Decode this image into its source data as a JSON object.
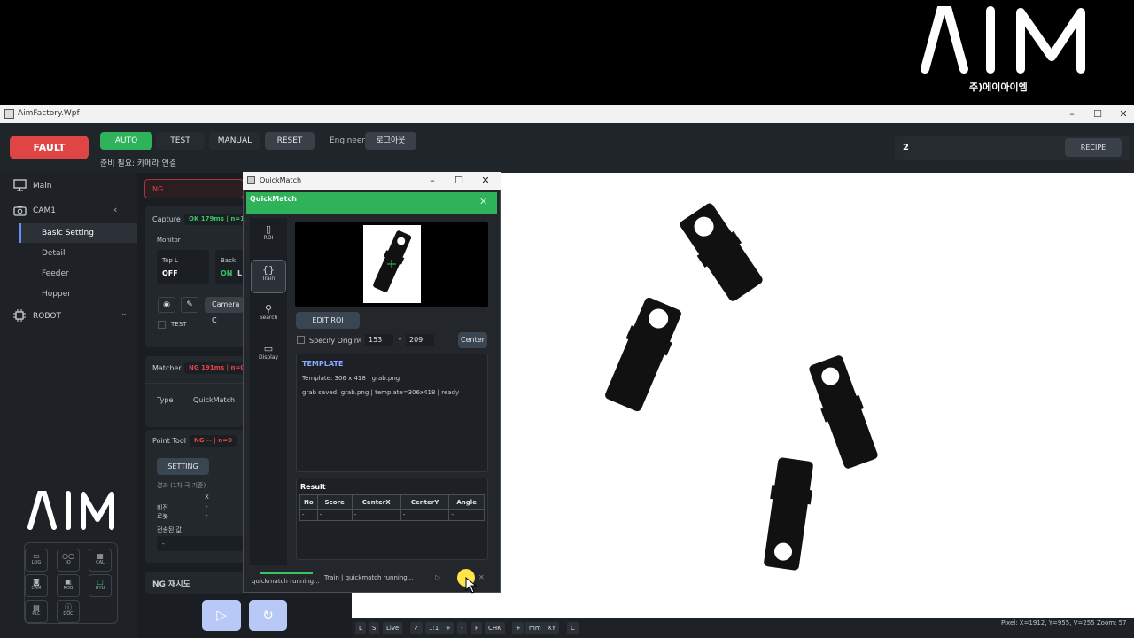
{
  "brand": {
    "logo_text": "AIM",
    "company_korean": "주)에이아이엠"
  },
  "window": {
    "title": "AimFactory.Wpf",
    "controls": [
      "–",
      "☐",
      "✕"
    ]
  },
  "topbar": {
    "fault": "FAULT",
    "modes": [
      "AUTO",
      "TEST",
      "MANUAL"
    ],
    "reset": "RESET",
    "user_role": "Engineer",
    "logout": "로그아웃",
    "status": "준비 필요: 카메라 연결",
    "count": "2",
    "recipe": "RECIPE"
  },
  "sidebar": {
    "main": "Main",
    "cam1": "CAM1",
    "cam1_items": [
      "Basic Setting",
      "Detail",
      "Feeder",
      "Hopper"
    ],
    "robot": "ROBOT",
    "logo": "AIM",
    "quick": [
      {
        "label": "LOG",
        "glyph": "▭"
      },
      {
        "label": "IO",
        "glyph": "○○"
      },
      {
        "label": "CAL",
        "glyph": "▦"
      },
      {
        "label": "CAM",
        "glyph": "◙"
      },
      {
        "label": "ROB",
        "glyph": "▣"
      },
      {
        "label": "HYU",
        "glyph": "□"
      },
      {
        "label": "PLC",
        "glyph": "▤"
      },
      {
        "label": "DOC",
        "glyph": "ⓘ"
      }
    ],
    "quick_hyu_color": "#37c463"
  },
  "middle": {
    "ng_field": "NG",
    "capture": {
      "title": "Capture",
      "status": "OK 179ms | n=1",
      "monitor": "Monitor",
      "top_l": "Top L",
      "top_l_val": "OFF",
      "back": "Back",
      "back_val": "ON",
      "back_extra": "L",
      "camera_btn": "Camera C",
      "test": "TEST"
    },
    "matcher": {
      "title": "Matcher",
      "status": "NG 191ms | n=0",
      "type_label": "Type",
      "type_val": "QuickMatch"
    },
    "point_tool": {
      "title": "Point Tool",
      "status": "NG -- | n=0",
      "setting": "SETTING",
      "result_label": "결과 (1차 국 기준)",
      "x_label": "X",
      "vision": "비전",
      "robot": "로봇",
      "vision_x": "-",
      "robot_x": "-",
      "sent": "전송된 값",
      "sent_val": "-"
    },
    "retry": "NG 재시도"
  },
  "quickmatch": {
    "title": "QuickMatch",
    "header": "QuickMatch",
    "tools": [
      "ROI",
      "Train",
      "Search",
      "Display"
    ],
    "edit_roi": "EDIT ROI",
    "specify_origin": "Specify Origin",
    "x_label": "X",
    "x_val": "153",
    "y_label": "Y",
    "y_val": "209",
    "center": "Center",
    "template_title": "TEMPLATE",
    "template_line1": "Template: 306 x 418 | grab.png",
    "template_line2": "grab saved: grab.png | template=306x418 | ready",
    "result_title": "Result",
    "columns": [
      "No",
      "Score",
      "CenterX",
      "CenterY",
      "Angle"
    ],
    "rows": [
      [
        "-",
        "-",
        "-",
        "-",
        "-"
      ]
    ],
    "status_left": "quickmatch running...",
    "status_right": "Train | quickmatch running..."
  },
  "toolbar": [
    "L",
    "S",
    "Live",
    "✓",
    "1:1",
    "+",
    "-",
    "P",
    "CHK",
    "+",
    "mm",
    "XY",
    "C"
  ],
  "pixel_info": "Pixel: X=1912, Y=955, V=255   Zoom: 57",
  "colors": {
    "fault": "#e04545",
    "auto": "#2fb35a",
    "ok": "#37c463",
    "ng": "#e04545",
    "accent": "#6b8cff"
  }
}
